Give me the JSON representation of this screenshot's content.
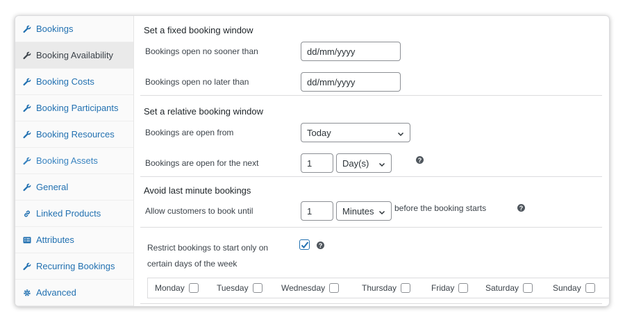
{
  "sidebar": {
    "items": [
      {
        "label": "Bookings",
        "icon": "wrench-icon"
      },
      {
        "label": "Booking Availability",
        "icon": "wrench-icon"
      },
      {
        "label": "Booking Costs",
        "icon": "wrench-icon"
      },
      {
        "label": "Booking Participants",
        "icon": "wrench-icon"
      },
      {
        "label": "Booking Resources",
        "icon": "wrench-icon"
      },
      {
        "label": "Booking Assets",
        "icon": "wrench-icon"
      },
      {
        "label": "General",
        "icon": "wrench-icon"
      },
      {
        "label": "Linked Products",
        "icon": "link-icon"
      },
      {
        "label": "Attributes",
        "icon": "list-icon"
      },
      {
        "label": "Recurring Bookings",
        "icon": "wrench-icon"
      },
      {
        "label": "Advanced",
        "icon": "gear-icon"
      }
    ],
    "active_index": 1
  },
  "fixed_window": {
    "title": "Set a fixed booking window",
    "open_no_sooner_label": "Bookings open no sooner than",
    "open_no_sooner_placeholder": "dd/mm/yyyy",
    "open_no_later_label": "Bookings open no later than",
    "open_no_later_placeholder": "dd/mm/yyyy"
  },
  "relative_window": {
    "title": "Set a relative booking window",
    "open_from_label": "Bookings are open from",
    "open_from_value": "Today",
    "open_next_label": "Bookings are open for the next",
    "open_next_value": "1",
    "open_next_unit": "Day(s)"
  },
  "last_minute": {
    "title": "Avoid last minute bookings",
    "allow_until_label": "Allow customers to book until",
    "allow_until_value": "1",
    "allow_until_unit": "Minutes",
    "after_text": "before the booking starts"
  },
  "restrict_days": {
    "label_line1": "Restrict bookings to start only on",
    "label_line2": "certain days of the week",
    "checked": true,
    "days": [
      "Monday",
      "Tuesday",
      "Wednesday",
      "Thursday",
      "Friday",
      "Saturday",
      "Sunday"
    ]
  },
  "colors": {
    "link": "#2271b1",
    "border": "#8c8f94",
    "help": "#50575e"
  },
  "help_glyph": "?"
}
